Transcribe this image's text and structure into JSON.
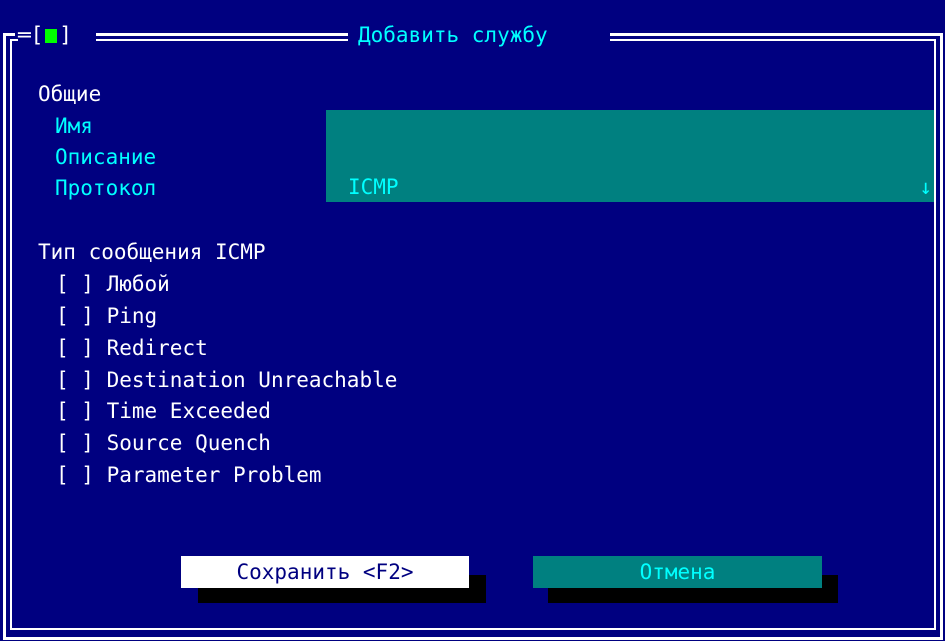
{
  "dialog": {
    "close_box_left": "═[",
    "close_box_right": "]",
    "title": "Добавить службу"
  },
  "general": {
    "heading": "Общие",
    "name_label": "Имя",
    "name_value": "",
    "description_label": "Описание",
    "description_value": "",
    "protocol_label": "Протокол",
    "protocol_value": "ICMP",
    "protocol_arrow": "↓"
  },
  "icmp": {
    "heading": "Тип сообщения ICMP",
    "items": [
      {
        "box": "[ ]",
        "label": "Любой"
      },
      {
        "box": "[ ]",
        "label": "Ping"
      },
      {
        "box": "[ ]",
        "label": "Redirect"
      },
      {
        "box": "[ ]",
        "label": "Destination Unreachable"
      },
      {
        "box": "[ ]",
        "label": "Time Exceeded"
      },
      {
        "box": "[ ]",
        "label": "Source Quench"
      },
      {
        "box": "[ ]",
        "label": "Parameter Problem"
      }
    ]
  },
  "buttons": {
    "save": "Сохранить <F2>",
    "cancel": "Отмена"
  },
  "colors": {
    "background": "#000080",
    "field": "#008080",
    "accent": "#00ffff",
    "close_indicator": "#00ff00"
  }
}
